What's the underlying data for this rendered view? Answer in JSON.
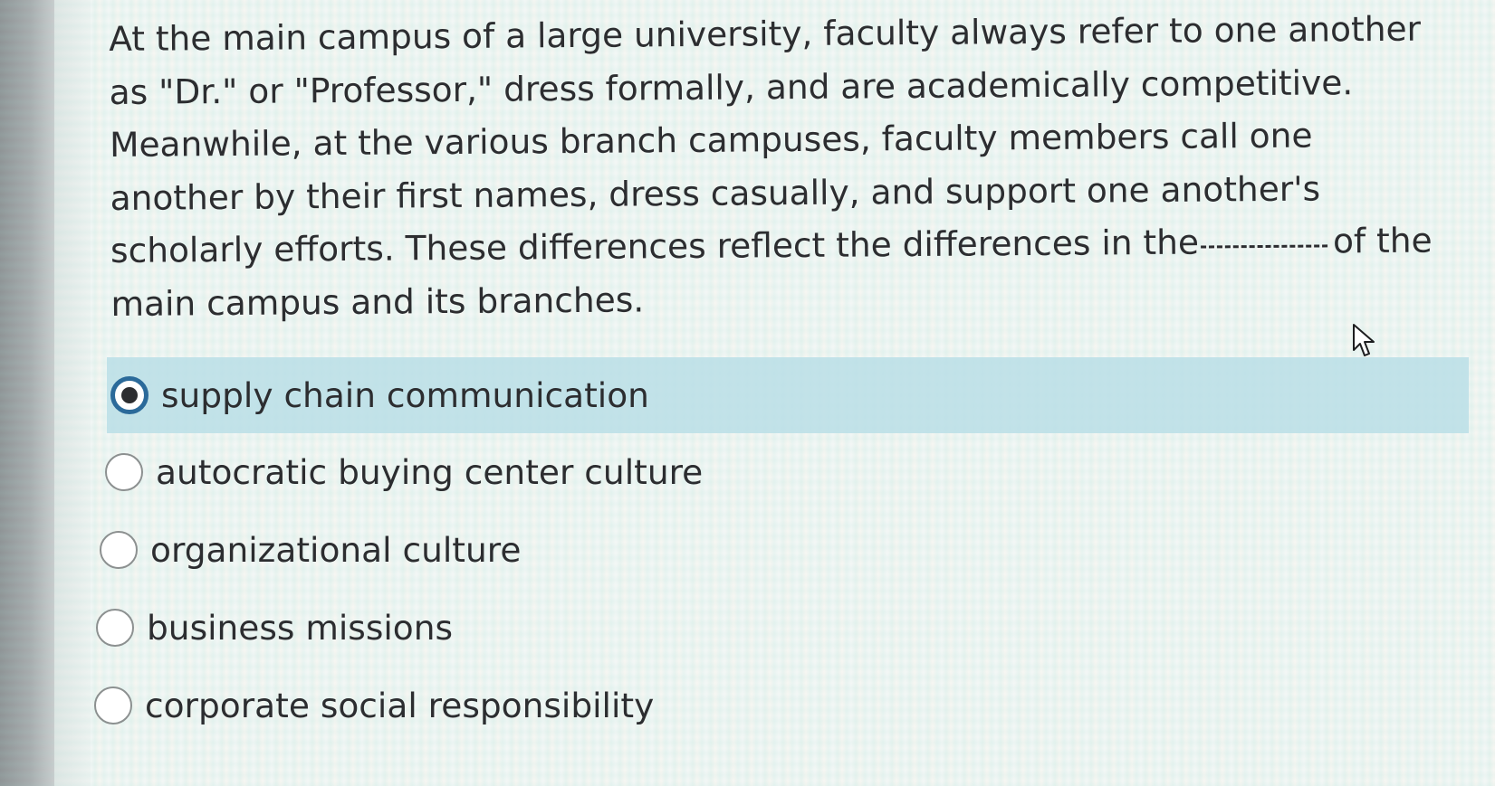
{
  "question": {
    "text_before_blank": "At the main campus of a large university, faculty always refer to one another as \"Dr.\" or \"Professor,\" dress formally, and are academically competitive. Meanwhile, at the various branch campuses, faculty members call one another by their first names, dress casually, and support one another's scholarly efforts. These differences reflect the differences in the",
    "text_after_blank": "of the main campus and its branches."
  },
  "options": [
    {
      "label": "supply chain communication",
      "selected": true
    },
    {
      "label": "autocratic buying center culture",
      "selected": false
    },
    {
      "label": "organizational culture",
      "selected": false
    },
    {
      "label": "business missions",
      "selected": false
    },
    {
      "label": "corporate social responsibility",
      "selected": false
    }
  ],
  "colors": {
    "text": "#2c2d30",
    "selected_highlight": "#badee6",
    "radio_checked_ring": "#2b6a9a"
  },
  "icons": {
    "cursor": "mouse-pointer-icon"
  }
}
